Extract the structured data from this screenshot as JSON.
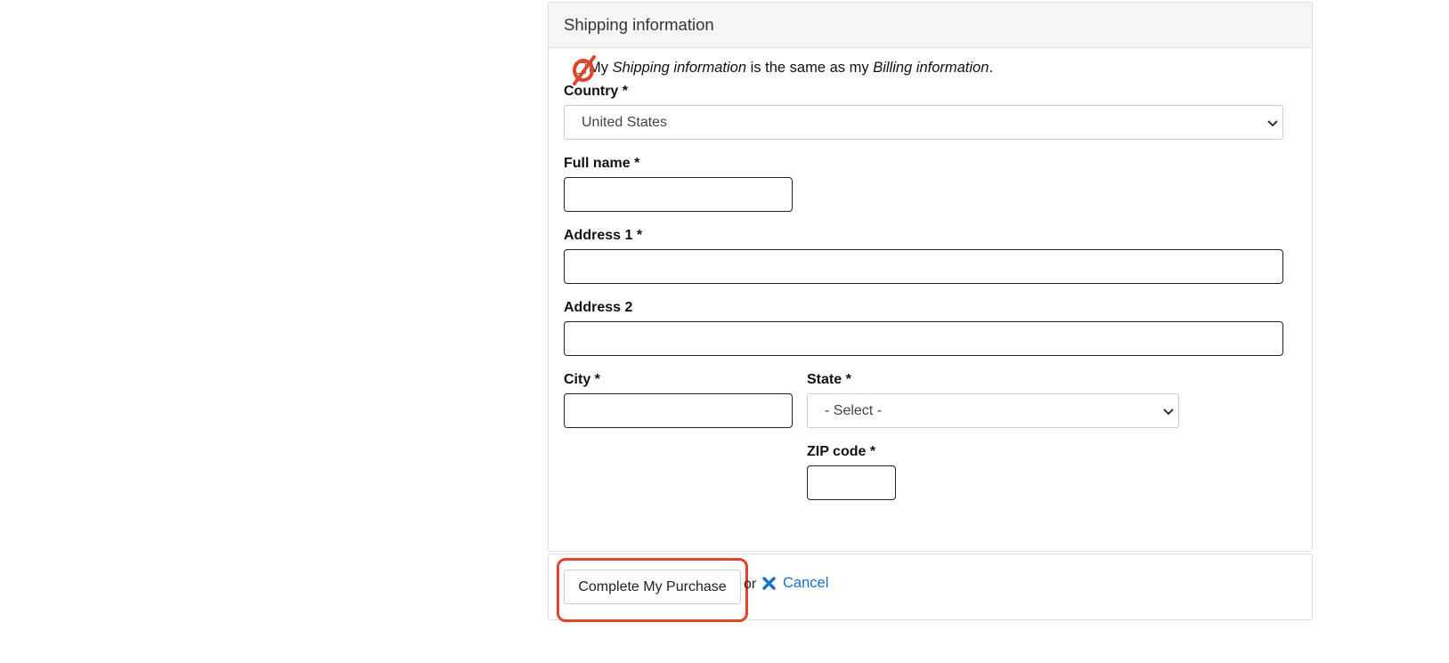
{
  "shipping": {
    "title": "Shipping information",
    "same_as_billing": {
      "prefix": "My",
      "em1": "Shipping information",
      "middle": "is the same as my",
      "em2": "Billing information",
      "suffix": "."
    },
    "country": {
      "label": "Country *",
      "value": "United States"
    },
    "full_name": {
      "label": "Full name *",
      "value": ""
    },
    "address1": {
      "label": "Address 1 *",
      "value": ""
    },
    "address2": {
      "label": "Address 2",
      "value": ""
    },
    "city": {
      "label": "City *",
      "value": ""
    },
    "state": {
      "label": "State *",
      "value": "- Select -"
    },
    "zip": {
      "label": "ZIP code *",
      "value": ""
    }
  },
  "actions": {
    "complete_label": "Complete My Purchase",
    "or_label": "or",
    "cancel_label": "Cancel"
  },
  "colors": {
    "highlight": "#e0452b",
    "link": "#1a6fc6",
    "panel_header_bg": "#f5f5f5"
  },
  "icons": [
    "no-entry-icon",
    "chevron-down-icon",
    "close-icon"
  ]
}
